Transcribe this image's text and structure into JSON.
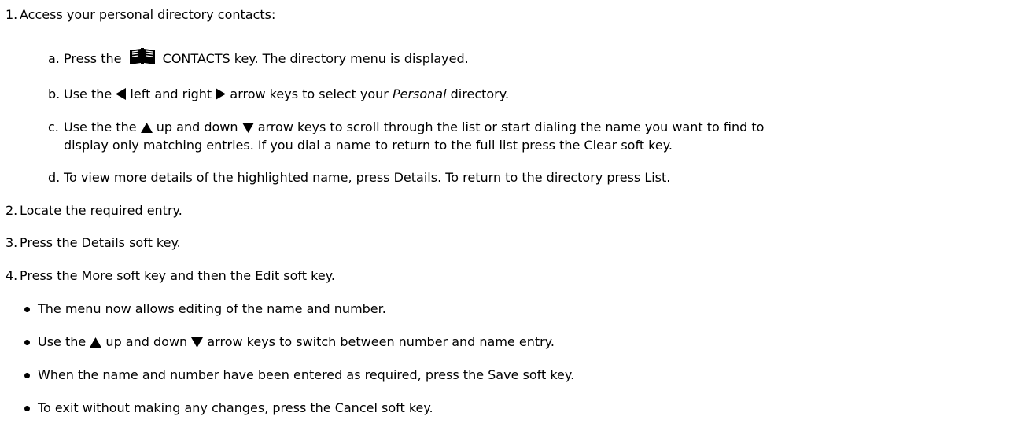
{
  "steps": [
    {
      "marker": "1.",
      "text": "Access your personal directory contacts:"
    },
    {
      "marker": "2.",
      "text": "Locate the required entry."
    },
    {
      "marker": "3.",
      "text": "Press the Details soft key."
    },
    {
      "marker": "4.",
      "text": "Press the More soft key and then the Edit soft key."
    }
  ],
  "substeps": {
    "a": {
      "marker": "a.",
      "pre": "Press the",
      "post": "CONTACTS key. The directory menu is displayed."
    },
    "b": {
      "marker": "b.",
      "pre": "Use the",
      "mid": "left and right",
      "post": "arrow keys to select your",
      "italic": "Personal",
      "tail": "directory."
    },
    "c": {
      "marker": "c.",
      "pre": "Use the the",
      "mid": "up and down",
      "post": "arrow keys to scroll through the list or start dialing the name you want to find to",
      "line2": "display only matching entries. If you dial a name to return to the full list press the Clear soft key."
    },
    "d": {
      "marker": "d.",
      "text": "To view more details of the highlighted name, press Details. To return to the directory press List."
    }
  },
  "bullets": [
    {
      "text": "The menu now allows editing of the name and number."
    },
    {
      "pre": "Use the",
      "mid": "up and down",
      "post": "arrow keys to switch between number and name entry."
    },
    {
      "text": "When the name and number have been entered as required, press the Save soft key."
    },
    {
      "text": "To exit without making any changes, press the Cancel soft key."
    }
  ],
  "icons": {
    "contacts": "book-icon",
    "left": "left-arrow-icon",
    "right": "right-arrow-icon",
    "up": "up-arrow-icon",
    "down": "down-arrow-icon"
  }
}
